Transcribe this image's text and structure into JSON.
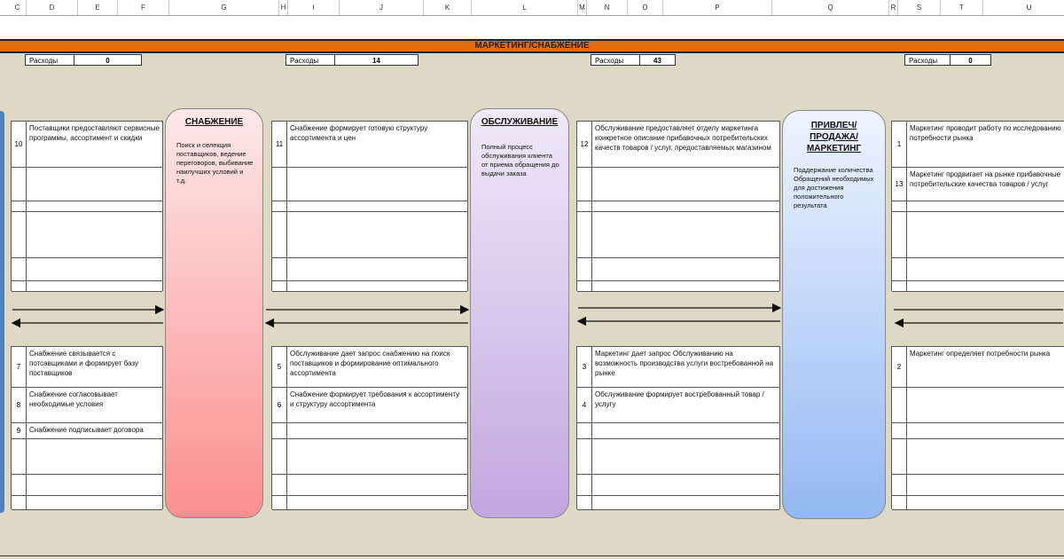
{
  "column_headers": [
    "C",
    "D",
    "E",
    "F",
    "G",
    "H",
    "I",
    "J",
    "K",
    "L",
    "M",
    "N",
    "O",
    "P",
    "Q",
    "R",
    "S",
    "T",
    "U"
  ],
  "title": "МАРКЕТИНГ/СНАБЖЕНИЕ",
  "expenses": [
    {
      "label": "Расходы",
      "value": "0"
    },
    {
      "label": "Расходы",
      "value": "14"
    },
    {
      "label": "Расходы",
      "value": "43"
    },
    {
      "label": "Расходы",
      "value": "0"
    }
  ],
  "departments": [
    {
      "title": "СНАБЖЕНИЕ",
      "description": "Поиск и селекция поставщиков, ведение переговоров, выбивание наилучших условий и т.д.",
      "color_top": "#fde8e8",
      "color_bottom": "#fb8f8f"
    },
    {
      "title": "ОБСЛУЖИВАНИЕ",
      "description": "Полный процесс обслуживания клиента от приема обращения до выдачи заказа",
      "color_top": "#efe9f8",
      "color_bottom": "#c2a7e0"
    },
    {
      "title": "ПРИВЛЕЧ/ПРОДАЖА/МАРКЕТИНГ",
      "description": "Поддержание количества Обращений необходимых для достижения положительного результата",
      "color_top": "#eef4ff",
      "color_bottom": "#94b8f2"
    }
  ],
  "tables": {
    "a_top": [
      {
        "num": "10",
        "text": "Поставщики предоставляют сервисные программы, ассортимент и скидки"
      },
      {
        "num": "",
        "text": ""
      },
      {
        "num": "",
        "text": ""
      },
      {
        "num": "",
        "text": ""
      },
      {
        "num": "",
        "text": ""
      },
      {
        "num": "",
        "text": ""
      }
    ],
    "a_bottom": [
      {
        "num": "7",
        "text": "Снабжение связывается с потсавщиками и формирует базу поставщиков"
      },
      {
        "num": "8",
        "text": "Снабжение согласовывает необходимые условия"
      },
      {
        "num": "9",
        "text": "Снабжение подписывает договора"
      },
      {
        "num": "",
        "text": ""
      },
      {
        "num": "",
        "text": ""
      },
      {
        "num": "",
        "text": ""
      }
    ],
    "b_top": [
      {
        "num": "11",
        "text": "Снабжение формирует готовую структуру ассортимента и цен"
      },
      {
        "num": "",
        "text": ""
      },
      {
        "num": "",
        "text": ""
      },
      {
        "num": "",
        "text": ""
      },
      {
        "num": "",
        "text": ""
      },
      {
        "num": "",
        "text": ""
      }
    ],
    "b_bottom": [
      {
        "num": "5",
        "text": "Обслуживание дает запрос снабжению на поиск поставщиков и формирование оптимального ассортимента"
      },
      {
        "num": "6",
        "text": "Снабжение формирует требования к ассортименту и структуру ассортимента"
      },
      {
        "num": "",
        "text": ""
      },
      {
        "num": "",
        "text": ""
      },
      {
        "num": "",
        "text": ""
      },
      {
        "num": "",
        "text": ""
      }
    ],
    "c_top": [
      {
        "num": "12",
        "text": "Обслуживание предоставляет отделу маркетинга конкретное описание прибавочных потребительских качеств товаров / услуг, предоставляемых магазином"
      },
      {
        "num": "",
        "text": ""
      },
      {
        "num": "",
        "text": ""
      },
      {
        "num": "",
        "text": ""
      },
      {
        "num": "",
        "text": ""
      },
      {
        "num": "",
        "text": ""
      }
    ],
    "c_bottom": [
      {
        "num": "3",
        "text": "Маркетинг дает запрос Обслуживанию на возможность производства услуги востребованной на рынке"
      },
      {
        "num": "4",
        "text": "Обслуживание формирует востребованный товар / услугу"
      },
      {
        "num": "",
        "text": ""
      },
      {
        "num": "",
        "text": ""
      },
      {
        "num": "",
        "text": ""
      },
      {
        "num": "",
        "text": ""
      }
    ],
    "d_top": [
      {
        "num": "1",
        "text": "Маркетинг проводит работу  по исследованию потребности рынка"
      },
      {
        "num": "13",
        "text": "Маркетинг продвигает на рынке прибавочные потребительские качества товаров / услуг"
      },
      {
        "num": "",
        "text": ""
      },
      {
        "num": "",
        "text": ""
      },
      {
        "num": "",
        "text": ""
      },
      {
        "num": "",
        "text": ""
      }
    ],
    "d_bottom": [
      {
        "num": "2",
        "text": "Маркетинг определяет потребности рынка"
      },
      {
        "num": "",
        "text": ""
      },
      {
        "num": "",
        "text": ""
      },
      {
        "num": "",
        "text": ""
      },
      {
        "num": "",
        "text": ""
      },
      {
        "num": "",
        "text": ""
      }
    ]
  }
}
